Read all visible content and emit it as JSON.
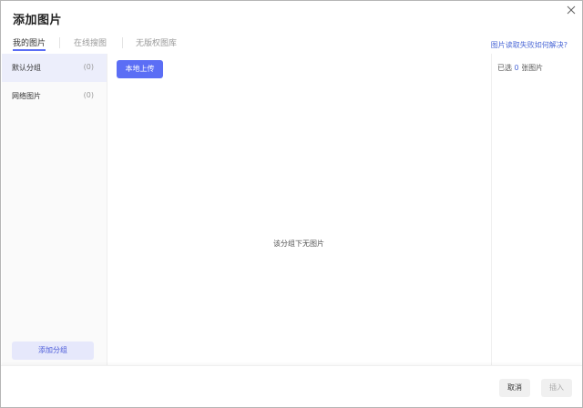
{
  "dialog": {
    "title": "添加图片",
    "close_icon": "close-icon"
  },
  "tabs": [
    {
      "label": "我的图片",
      "active": true
    },
    {
      "label": "在线搜图",
      "active": false
    },
    {
      "label": "无版权图库",
      "active": false
    }
  ],
  "help_link": "图片读取失败如何解决?",
  "sidebar": {
    "groups": [
      {
        "label": "默认分组",
        "count": "(0)",
        "active": true
      },
      {
        "label": "网络图片",
        "count": "(0)",
        "active": false
      }
    ],
    "add_group_label": "添加分组"
  },
  "main": {
    "upload_label": "本地上传",
    "empty_text": "该分组下无图片"
  },
  "right_panel": {
    "selected_prefix": "已选",
    "selected_count": "0",
    "selected_suffix": "张图片"
  },
  "footer": {
    "cancel_label": "取消",
    "insert_label": "插入"
  },
  "colors": {
    "accent": "#5b6ef5",
    "link": "#4a67d6",
    "active_group_bg": "#eceefb"
  }
}
